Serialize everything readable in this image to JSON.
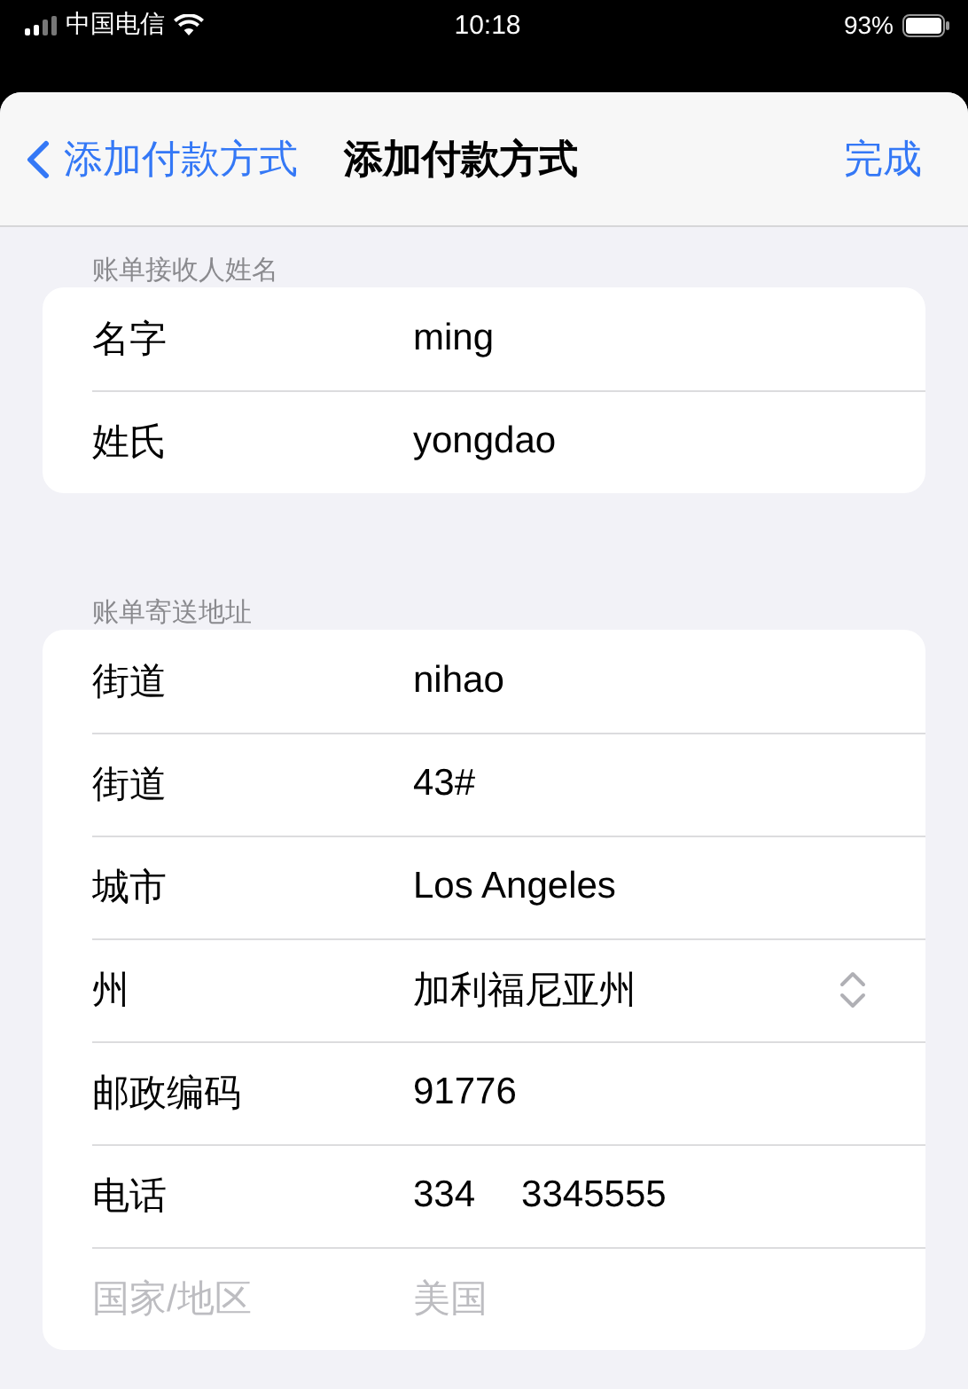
{
  "status_bar": {
    "carrier": "中国电信",
    "time": "10:18",
    "battery": "93%"
  },
  "nav": {
    "back": "添加付款方式",
    "title": "添加付款方式",
    "done": "完成"
  },
  "sections": [
    {
      "header": "账单接收人姓名",
      "rows": [
        {
          "kind": "text",
          "label": "名字",
          "value": "ming",
          "disabled": false
        },
        {
          "kind": "text",
          "label": "姓氏",
          "value": "yongdao",
          "disabled": false
        }
      ]
    },
    {
      "header": "账单寄送地址",
      "rows": [
        {
          "kind": "text",
          "label": "街道",
          "value": "nihao",
          "disabled": false
        },
        {
          "kind": "text",
          "label": "街道",
          "value": "43#",
          "disabled": false
        },
        {
          "kind": "text",
          "label": "城市",
          "value": "Los Angeles",
          "disabled": false
        },
        {
          "kind": "picker",
          "label": "州",
          "value": "加利福尼亚州",
          "disabled": false
        },
        {
          "kind": "text",
          "label": "邮政编码",
          "value": "91776",
          "disabled": false
        },
        {
          "kind": "phone",
          "label": "电话",
          "area": "334",
          "value": "3345555",
          "disabled": false
        },
        {
          "kind": "text",
          "label": "国家/地区",
          "value": "美国",
          "disabled": true
        }
      ]
    }
  ]
}
